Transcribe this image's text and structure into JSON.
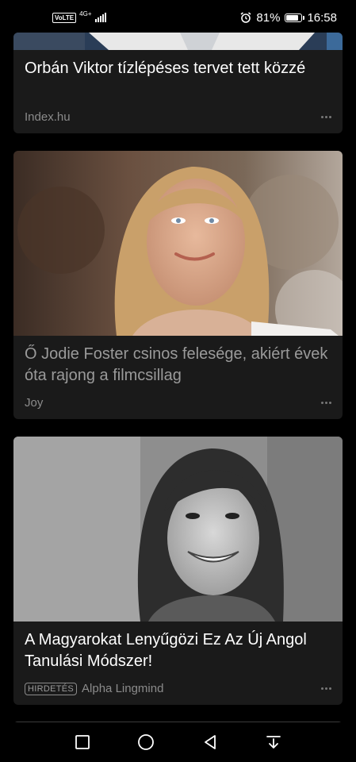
{
  "status": {
    "volte": "VoLTE",
    "network": "4G+",
    "battery_pct": "81%",
    "battery_level": 0.81,
    "time": "16:58"
  },
  "cards": [
    {
      "title": "Orbán Viktor tízlépéses tervet tett közzé",
      "source": "Index.hu"
    },
    {
      "title": "Ő Jodie Foster csinos felesége, akiért évek óta rajong a filmcsillag",
      "source": "Joy"
    },
    {
      "title": "A Magyarokat Lenyűgözi Ez Az Új Angol Tanulási Módszer!",
      "badge": "HIRDETÉS",
      "source": "Alpha Lingmind"
    }
  ],
  "icons": {
    "alarm": "alarm-icon",
    "more": "more-dots-icon",
    "nav": [
      "square-icon",
      "circle-home-icon",
      "triangle-back-icon",
      "download-arrow-icon"
    ]
  }
}
